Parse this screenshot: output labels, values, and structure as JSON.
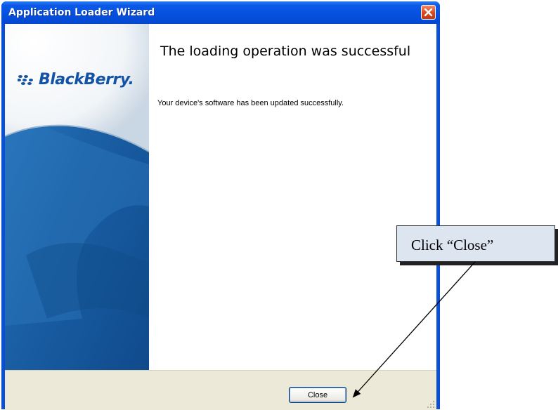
{
  "window": {
    "title": "Application Loader Wizard",
    "close_icon": "close-icon"
  },
  "side_panel": {
    "logo_text": "BlackBerry.",
    "logo_icon": "blackberry-logo-icon"
  },
  "content": {
    "heading": "The loading operation was successful",
    "message": "Your device's software has been updated successfully."
  },
  "footer": {
    "close_label": "Close"
  },
  "annotation": {
    "callout_text": "Click “Close”"
  },
  "colors": {
    "titlebar": "#0550df",
    "panel_blue": "#1a5ea3",
    "footer_bg": "#ece9d8",
    "callout_bg": "#dde6f0"
  }
}
